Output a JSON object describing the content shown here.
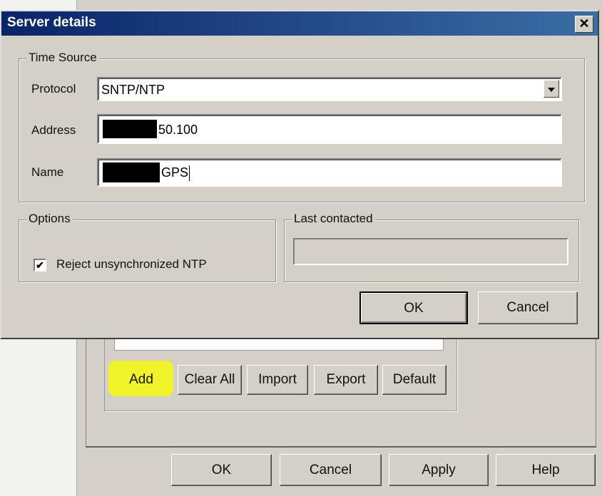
{
  "parent_window": {
    "buttons": [
      "Add",
      "Clear All",
      "Import",
      "Export",
      "Default"
    ],
    "footer_buttons": [
      "OK",
      "Cancel",
      "Apply",
      "Help"
    ],
    "highlight_color": "#f1f32a"
  },
  "dialog": {
    "title": "Server details",
    "close_glyph": "✕",
    "time_source": {
      "legend": "Time Source",
      "protocol_label": "Protocol",
      "protocol_value": "SNTP/NTP",
      "address_label": "Address",
      "address_value": "50.100",
      "name_label": "Name",
      "name_value": "GPS"
    },
    "options": {
      "legend": "Options",
      "checkbox_label": "Reject unsynchronized NTP",
      "checkbox_checked": true,
      "check_glyph": "✔"
    },
    "last_contacted": {
      "legend": "Last contacted",
      "value": ""
    },
    "ok_label": "OK",
    "cancel_label": "Cancel"
  }
}
